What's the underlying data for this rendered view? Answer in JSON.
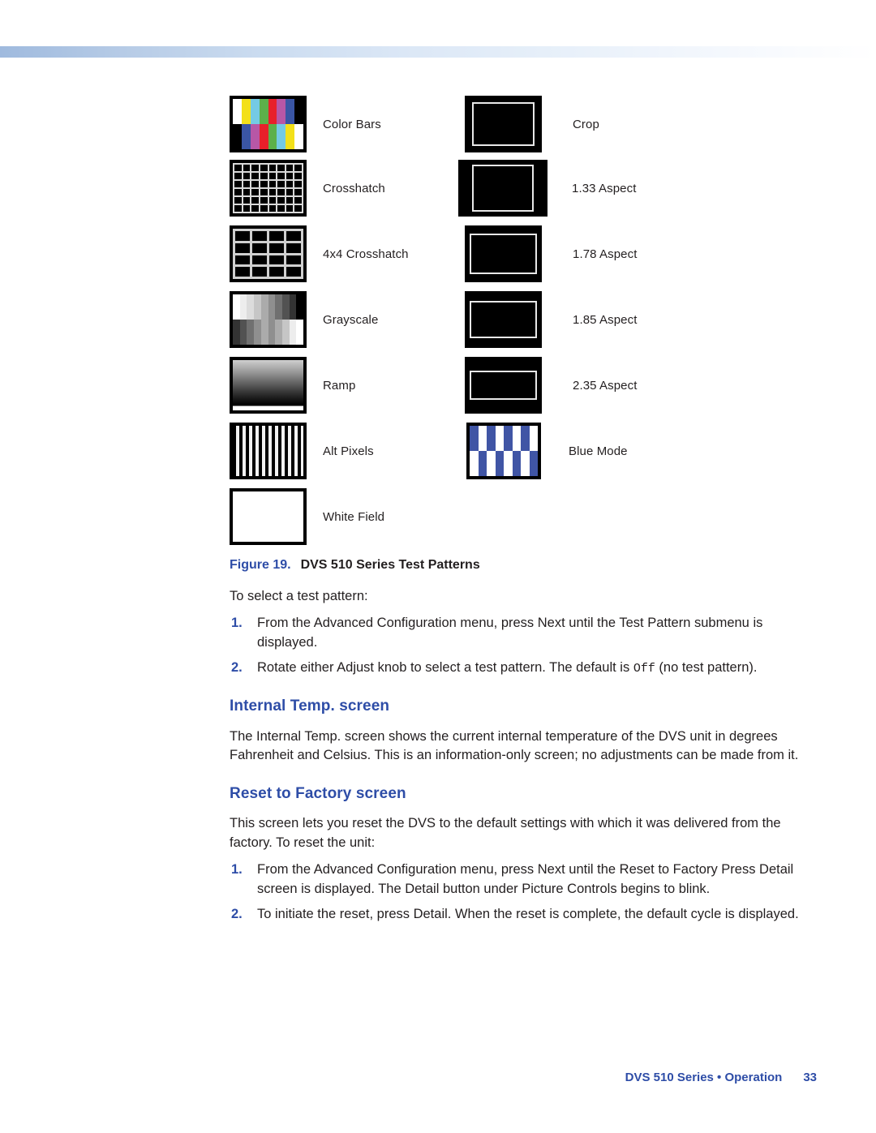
{
  "page": {
    "footer_text": "DVS 510 Series • Operation",
    "page_number": "33",
    "accent_color": "#2e4da7"
  },
  "figure": {
    "number_label": "Figure 19.",
    "title": "DVS 510 Series Test Patterns",
    "patterns_left": [
      {
        "name": "color-bars",
        "label": "Color Bars"
      },
      {
        "name": "crosshatch",
        "label": "Crosshatch"
      },
      {
        "name": "4x4-crosshatch",
        "label": "4x4 Crosshatch"
      },
      {
        "name": "grayscale",
        "label": "Grayscale"
      },
      {
        "name": "ramp",
        "label": "Ramp"
      },
      {
        "name": "alt-pixels",
        "label": "Alt Pixels"
      },
      {
        "name": "white-field",
        "label": "White Field"
      }
    ],
    "patterns_right": [
      {
        "name": "crop",
        "label": "Crop"
      },
      {
        "name": "aspect-133",
        "label": "1.33 Aspect"
      },
      {
        "name": "aspect-178",
        "label": "1.78 Aspect"
      },
      {
        "name": "aspect-185",
        "label": "1.85 Aspect"
      },
      {
        "name": "aspect-235",
        "label": "2.35 Aspect"
      },
      {
        "name": "blue-mode",
        "label": "Blue Mode"
      }
    ],
    "colorbars_top": [
      "#ffffff",
      "#f2e21c",
      "#6ec9e0",
      "#5bb04b",
      "#e81c23",
      "#b löschen",
      "#3b55a4",
      "#000000"
    ],
    "colorbars_colors_top": [
      "#ffffff",
      "#f3e019",
      "#74cae4",
      "#5cb04a",
      "#e8202a",
      "#b757a6",
      "#3a55a4",
      "#000000"
    ],
    "colorbars_colors_bottom": [
      "#000000",
      "#3a55a4",
      "#b757a6",
      "#e8202a",
      "#5cb04a",
      "#74cae4",
      "#f3e019",
      "#ffffff"
    ],
    "bluemode_color": "#4055a5"
  },
  "content": {
    "intro": "To select a test pattern:",
    "steps_testpattern": [
      {
        "num": "1.",
        "text": "From the Advanced Configuration menu, press Next until the Test Pattern submenu is displayed."
      },
      {
        "num": "2.",
        "text_before": "Rotate either Adjust knob to select a test pattern. The default is ",
        "mono": "Off",
        "text_after": " (no test pattern)."
      }
    ],
    "internal_temp_heading": "Internal Temp. screen",
    "internal_temp_body": "The Internal Temp. screen shows the current internal temperature of the DVS unit in degrees Fahrenheit and Celsius. This is an information-only screen; no adjustments can be made from it.",
    "reset_heading": "Reset to Factory screen",
    "reset_body": "This screen lets you reset the DVS to the default settings with which it was delivered from the factory. To reset the unit:",
    "steps_reset": [
      {
        "num": "1.",
        "text": "From the Advanced Configuration menu, press Next until the Reset to Factory Press Detail screen is displayed. The Detail button under Picture Controls begins to blink."
      },
      {
        "num": "2.",
        "text": "To initiate the reset, press Detail. When the reset is complete, the default cycle is displayed."
      }
    ]
  }
}
